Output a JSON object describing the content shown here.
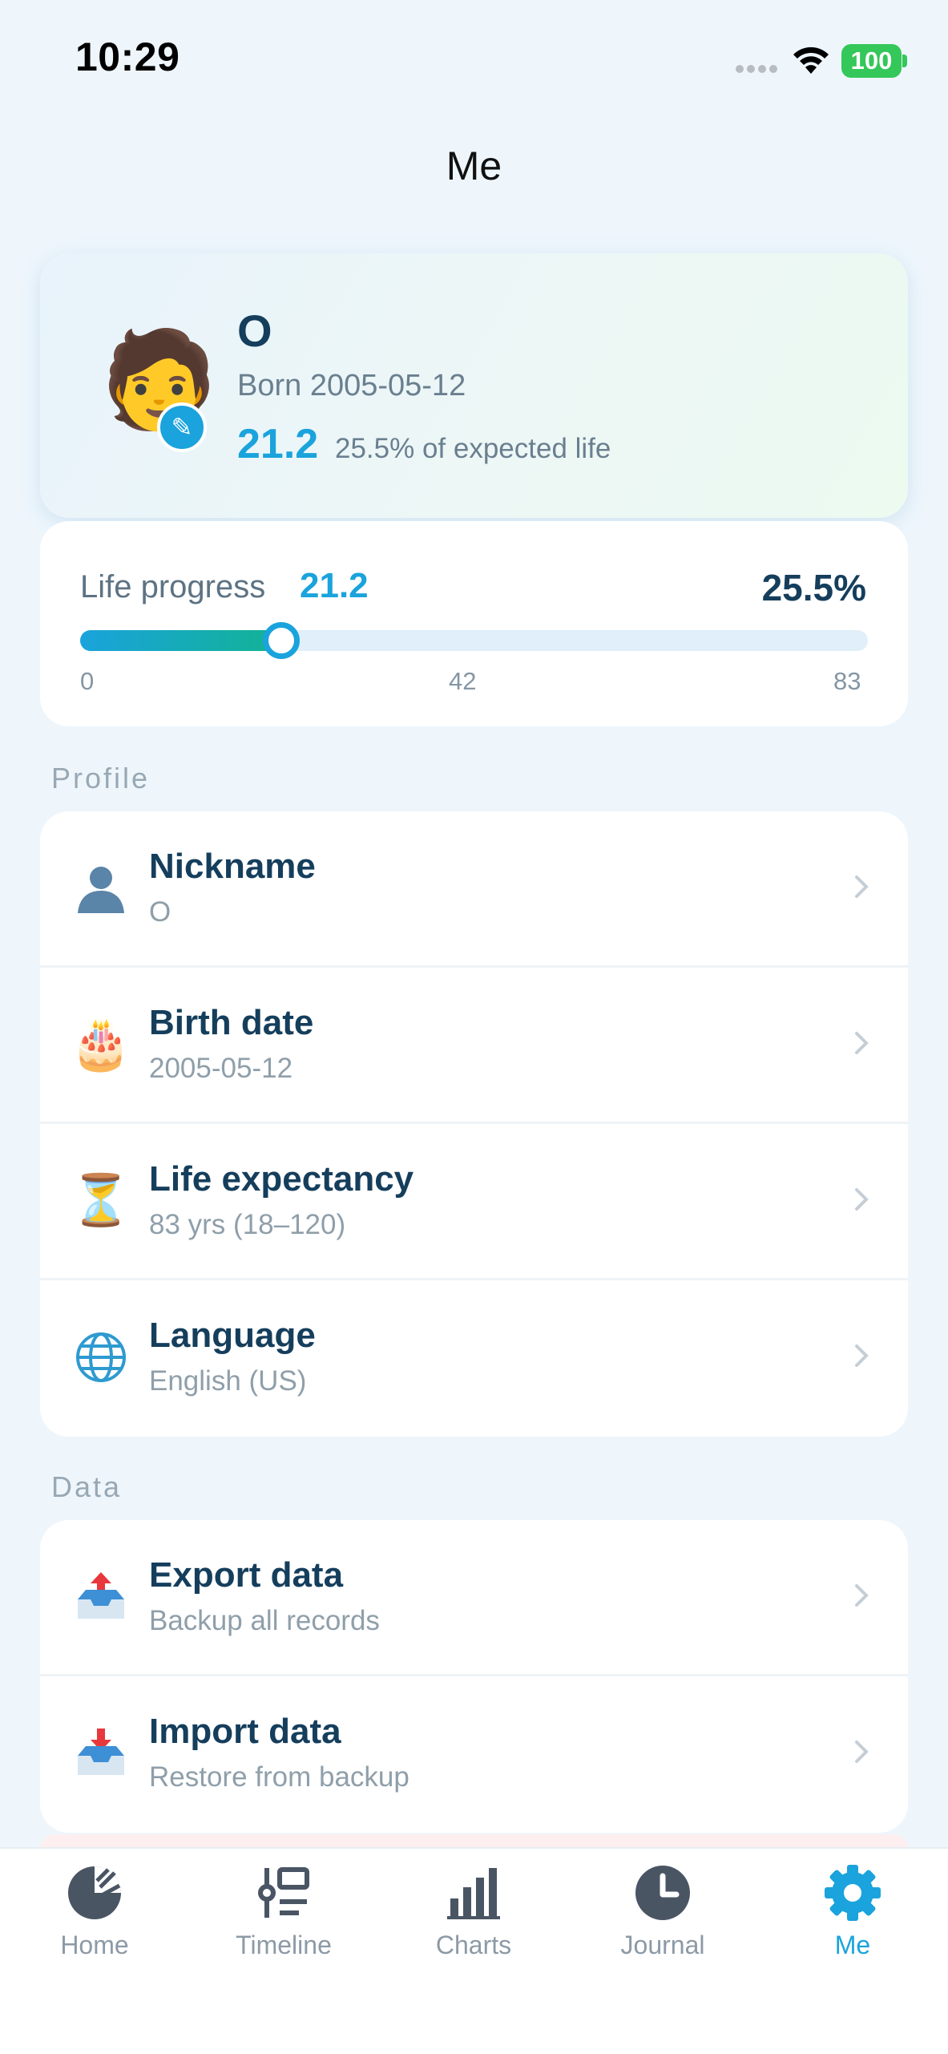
{
  "status_bar": {
    "time": "10:29",
    "battery": "100"
  },
  "header": {
    "title": "Me"
  },
  "profile": {
    "name": "O",
    "born": "Born 2005-05-12",
    "age": "21.2",
    "percent_text": "25.5% of expected life"
  },
  "life_progress": {
    "label": "Life progress",
    "age": "21.2",
    "percent": "25.5%",
    "fraction": 0.255,
    "ticks": [
      "0",
      "42",
      "83"
    ]
  },
  "sections": {
    "profile": {
      "label": "Profile",
      "items": [
        {
          "title": "Nickname",
          "subtitle": "O",
          "icon": "person-silhouette-icon"
        },
        {
          "title": "Birth date",
          "subtitle": "2005-05-12",
          "icon": "birthday-cake-icon"
        },
        {
          "title": "Life expectancy",
          "subtitle": "83 yrs (18–120)",
          "icon": "hourglass-icon"
        },
        {
          "title": "Language",
          "subtitle": "English (US)",
          "icon": "globe-icon"
        }
      ]
    },
    "data": {
      "label": "Data",
      "items": [
        {
          "title": "Export data",
          "subtitle": "Backup all records",
          "icon": "outbox-tray-icon"
        },
        {
          "title": "Import data",
          "subtitle": "Restore from backup",
          "icon": "inbox-tray-icon"
        }
      ]
    }
  },
  "tabs": [
    {
      "label": "Home",
      "icon": "pie-chart-icon"
    },
    {
      "label": "Timeline",
      "icon": "timeline-icon"
    },
    {
      "label": "Charts",
      "icon": "bar-chart-icon"
    },
    {
      "label": "Journal",
      "icon": "clock-icon"
    },
    {
      "label": "Me",
      "icon": "gear-icon",
      "active": true
    }
  ],
  "colors": {
    "accent": "#1aa3dc",
    "accent_green": "#12b394",
    "text_dark": "#153e5c",
    "background": "#eef6fc"
  }
}
